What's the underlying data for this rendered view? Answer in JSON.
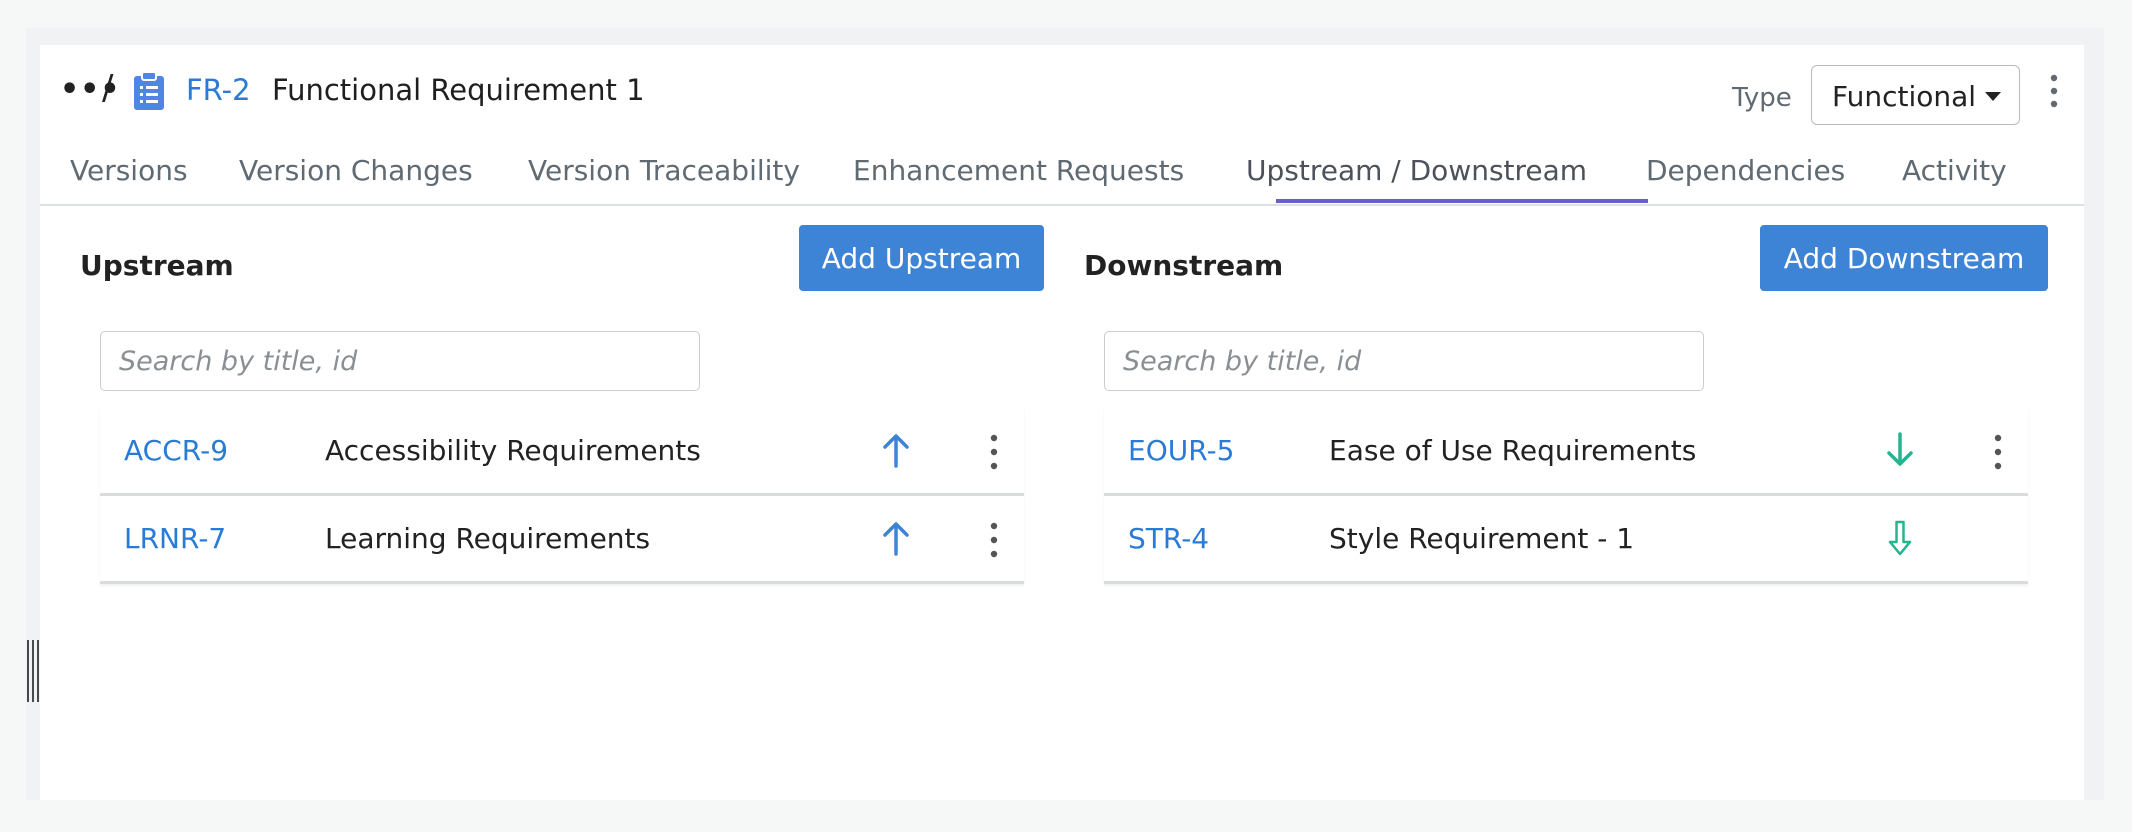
{
  "header": {
    "more_label": "•••",
    "separator": "/",
    "requirement_id": "FR-2",
    "requirement_title": "Functional Requirement 1",
    "type_label": "Type",
    "type_value": "Functional"
  },
  "tabs": [
    {
      "label": "Versions"
    },
    {
      "label": "Version Changes"
    },
    {
      "label": "Version Traceability"
    },
    {
      "label": "Enhancement Requests"
    },
    {
      "label": "Upstream / Downstream",
      "active": true
    },
    {
      "label": "Dependencies"
    },
    {
      "label": "Activity"
    }
  ],
  "upstream": {
    "title": "Upstream",
    "add_label": "Add Upstream",
    "search_placeholder": "Search by title, id",
    "items": [
      {
        "id": "ACCR-9",
        "title": "Accessibility Requirements",
        "icon": "arrow-up-icon"
      },
      {
        "id": "LRNR-7",
        "title": "Learning Requirements",
        "icon": "arrow-up-icon"
      }
    ]
  },
  "downstream": {
    "title": "Downstream",
    "add_label": "Add Downstream",
    "search_placeholder": "Search by title, id",
    "items": [
      {
        "id": "EOUR-5",
        "title": "Ease of Use Requirements",
        "icon": "arrow-down-icon"
      },
      {
        "id": "STR-4",
        "title": "Style Requirement - 1",
        "icon": "arrow-down-outline-icon"
      }
    ]
  },
  "colors": {
    "link": "#2a7bd5",
    "primary_button": "#3d84d6",
    "active_tab_underline": "#6a5fc7",
    "upstream_arrow": "#3d84d6",
    "downstream_arrow": "#23b58f"
  }
}
